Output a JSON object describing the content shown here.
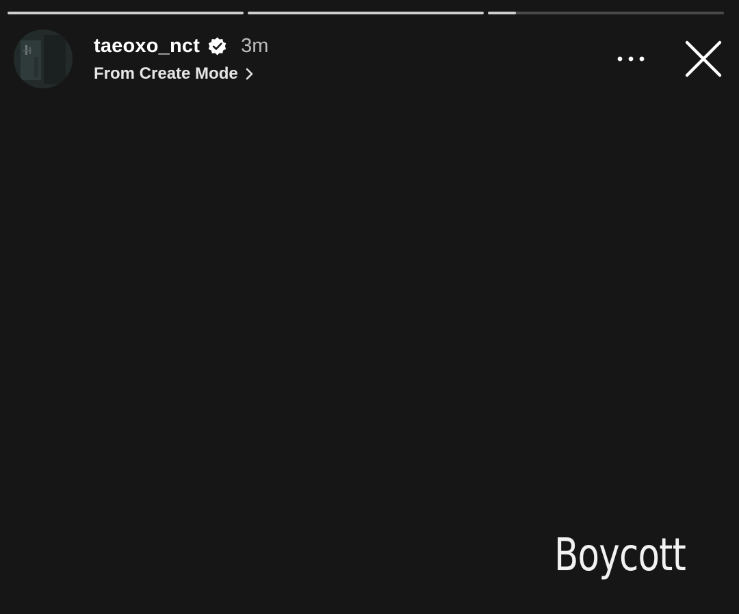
{
  "progress": {
    "segments": [
      {
        "fill": 1.0
      },
      {
        "fill": 1.0
      },
      {
        "fill": 0.12
      }
    ]
  },
  "header": {
    "username": "taeoxo_nct",
    "verified": true,
    "timestamp": "3m",
    "subtitle": "From Create Mode"
  },
  "icons": {
    "avatar": "avatar",
    "verified": "verified-badge-icon",
    "subtitle_chevron": "chevron-right-icon",
    "more": "more-horizontal-icon",
    "close": "close-icon"
  },
  "story": {
    "caption": "Boycott"
  },
  "colors": {
    "background": "#161616",
    "progress_track": "#4a4a4a",
    "progress_fill": "#cfcfcf",
    "text_primary": "#ffffff",
    "text_secondary": "#bdbdbd"
  }
}
